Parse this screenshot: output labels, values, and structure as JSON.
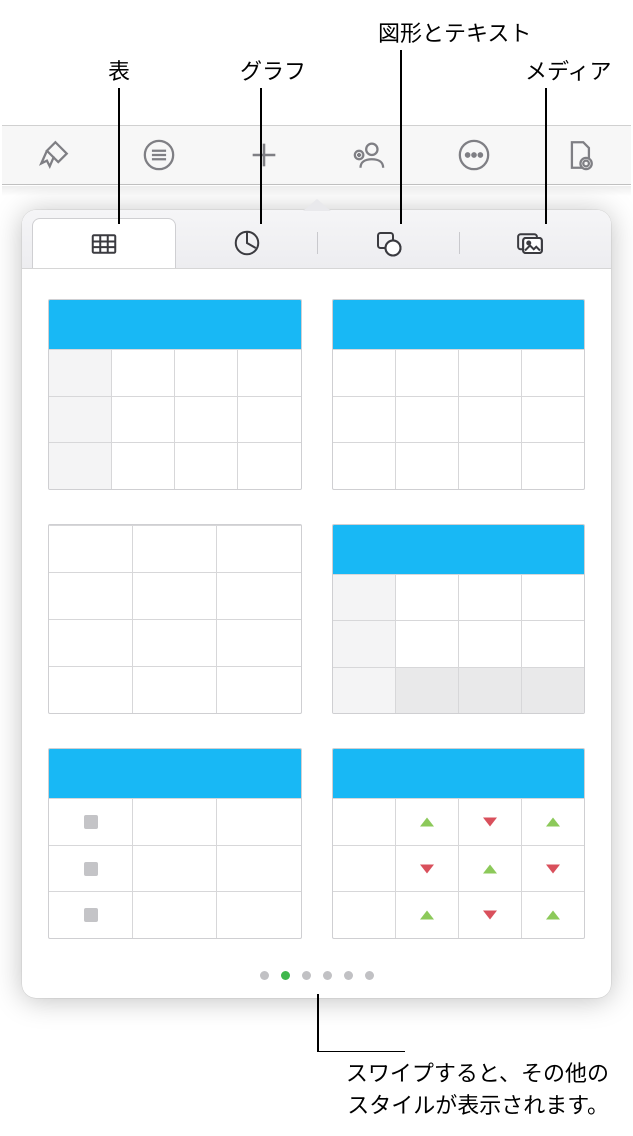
{
  "callouts": {
    "table": "表",
    "chart": "グラフ",
    "shape_text": "図形とテキスト",
    "media": "メディア"
  },
  "toolbar": {
    "format_icon": "format-brush-icon",
    "layers_icon": "layers-icon",
    "add_icon": "plus-icon",
    "collab_icon": "collaborate-icon",
    "more_icon": "more-icon",
    "document_icon": "document-icon"
  },
  "segments": {
    "table_icon": "table-icon",
    "chart_icon": "pie-chart-icon",
    "shape_icon": "shape-icon",
    "media_icon": "media-icon",
    "active_index": 0
  },
  "page_dots": {
    "count": 6,
    "active_index": 1
  },
  "bottom_hint": {
    "line1": "スワイプすると、その他の",
    "line2": "スタイルが表示されます。"
  }
}
